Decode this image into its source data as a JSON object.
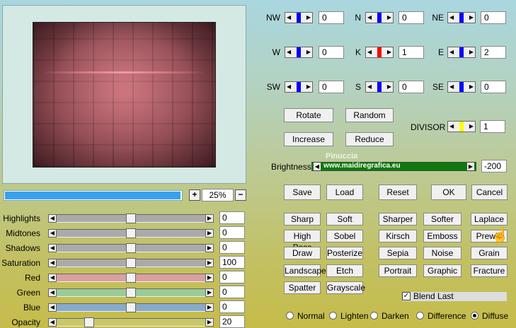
{
  "colors": {
    "accent_blue": "#0000ff",
    "center_red": "#ff0000",
    "divisor_yellow": "#ffff00",
    "brightness_green": "#0d7a0d",
    "progress_blue": "#3aa0ee"
  },
  "zoom": {
    "plus": "+",
    "minus": "−",
    "value": "25%"
  },
  "progress_fraction": 0.99,
  "sliders": [
    {
      "label": "Highlights",
      "value": "0",
      "track_color": "#aaaaaa",
      "level": 0.5
    },
    {
      "label": "Midtones",
      "value": "0",
      "track_color": "#aaaaaa",
      "level": 0.5
    },
    {
      "label": "Shadows",
      "value": "0",
      "track_color": "#aaaaaa",
      "level": 0.5
    },
    {
      "label": "Saturation",
      "value": "100",
      "track_color": "#aaaaaa",
      "level": 0.5
    },
    {
      "label": "Red",
      "value": "0",
      "track_color": "#d9a0a0",
      "level": 0.5
    },
    {
      "label": "Green",
      "value": "0",
      "track_color": "#99cc99",
      "level": 0.5
    },
    {
      "label": "Blue",
      "value": "0",
      "track_color": "#88aacc",
      "level": 0.5
    },
    {
      "label": "Opacity",
      "value": "20",
      "track_color": "#c8c86a",
      "level": 0.2
    }
  ],
  "matrix": [
    {
      "label": "NW",
      "value": "0",
      "marker": "#0000ff"
    },
    {
      "label": "N",
      "value": "0",
      "marker": "#0000ff"
    },
    {
      "label": "NE",
      "value": "0",
      "marker": "#0000ff"
    },
    {
      "label": "W",
      "value": "0",
      "marker": "#0000ff"
    },
    {
      "label": "K",
      "value": "1",
      "marker": "#ff0000"
    },
    {
      "label": "E",
      "value": "2",
      "marker": "#0000ff"
    },
    {
      "label": "SW",
      "value": "0",
      "marker": "#0000ff"
    },
    {
      "label": "S",
      "value": "0",
      "marker": "#0000ff"
    },
    {
      "label": "SE",
      "value": "0",
      "marker": "#0000ff"
    }
  ],
  "buttons": {
    "rotate": "Rotate",
    "random": "Random",
    "increase": "Increase",
    "reduce": "Reduce",
    "save": "Save",
    "load": "Load",
    "reset": "Reset",
    "ok": "OK",
    "cancel": "Cancel"
  },
  "divisor": {
    "label": "DIVISOR",
    "value": "1"
  },
  "brightness": {
    "label": "Brightness",
    "value": "-200"
  },
  "watermark": {
    "line1": "Pinuccia",
    "line2": "www.maidiregrafica.eu"
  },
  "presets": [
    [
      "Sharp",
      "Soft",
      "Sharper",
      "Softer",
      "Laplace"
    ],
    [
      "High Pass",
      "Sobel",
      "Kirsch",
      "Emboss",
      "Prewitt"
    ],
    [
      "Draw",
      "Posterize",
      "Sepia",
      "Noise",
      "Grain"
    ],
    [
      "Landscape",
      "Etch",
      "Portrait",
      "Graphic",
      "Fracture"
    ],
    [
      "Spatter",
      "Grayscale"
    ]
  ],
  "blend_last": {
    "label": "Blend Last",
    "checked": true
  },
  "blend_modes": [
    {
      "label": "Normal",
      "selected": false
    },
    {
      "label": "Lighten",
      "selected": false
    },
    {
      "label": "Darken",
      "selected": false
    },
    {
      "label": "Difference",
      "selected": false
    },
    {
      "label": "Diffuse",
      "selected": true
    }
  ]
}
